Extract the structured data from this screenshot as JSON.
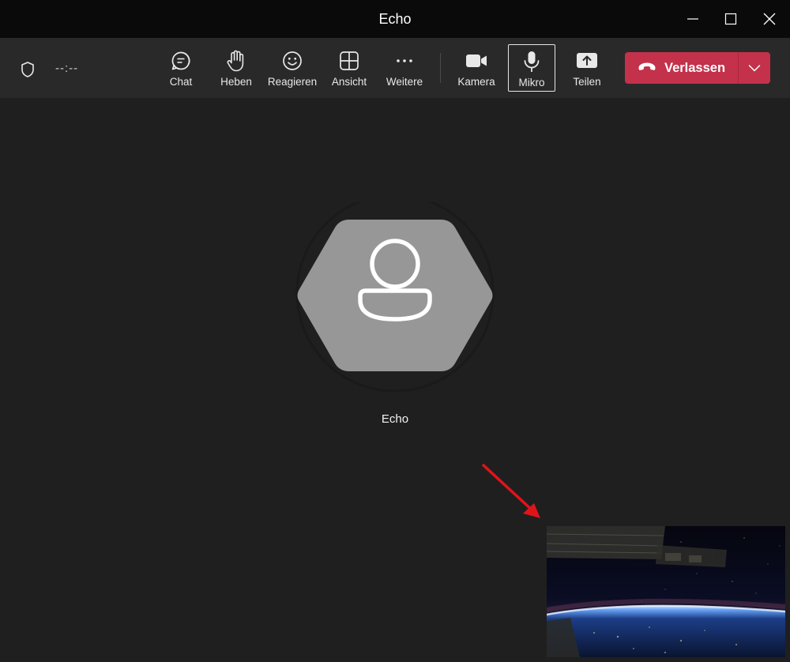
{
  "window": {
    "title": "Echo",
    "controls": [
      "minimize-icon",
      "maximize-icon",
      "close-icon"
    ]
  },
  "toolbar": {
    "timer": "--:--",
    "buttons": [
      {
        "label": "Chat",
        "icon": "chat-icon"
      },
      {
        "label": "Heben",
        "icon": "raise-hand-icon"
      },
      {
        "label": "Reagieren",
        "icon": "react-emoji-icon"
      },
      {
        "label": "Ansicht",
        "icon": "view-grid-icon"
      },
      {
        "label": "Weitere",
        "icon": "more-icon"
      },
      {
        "label": "Kamera",
        "icon": "camera-icon"
      },
      {
        "label": "Mikro",
        "icon": "microphone-icon",
        "active": true
      },
      {
        "label": "Teilen",
        "icon": "share-screen-icon"
      }
    ],
    "leave": {
      "label": "Verlassen",
      "color": "#c4314b"
    }
  },
  "stage": {
    "participant_name": "Echo",
    "self_view": "earth-from-space-video"
  },
  "colors": {
    "titlebar": "#0a0a0a",
    "toolbar": "#292929",
    "stage": "#1f1f1f",
    "avatar": "#979797",
    "annotation_arrow": "#e0141a"
  }
}
